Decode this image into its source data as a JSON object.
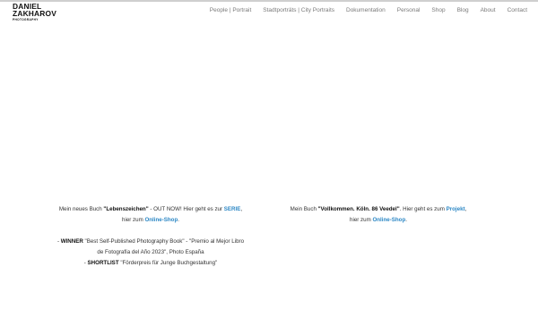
{
  "brand": {
    "line1": "DANIEL",
    "line2": "ZAKHAROV",
    "tagline": "PHOTOGRAPHY"
  },
  "nav": [
    {
      "label": "People | Portrait"
    },
    {
      "label": "Stadtporträts | City Portraits"
    },
    {
      "label": "Dokumentation"
    },
    {
      "label": "Personal"
    },
    {
      "label": "Shop"
    },
    {
      "label": "Blog"
    },
    {
      "label": "About"
    },
    {
      "label": "Contact"
    }
  ],
  "left": {
    "l1_pre": "Mein neues Buch ",
    "l1_title": "\"Lebenszeichen\"",
    "l1_mid": " - OUT NOW! Hier geht es zur ",
    "l1_link": "SERIE",
    "l1_end": ",",
    "l2_pre": "hier zum ",
    "l2_link": "Online-Shop",
    "l2_end": ".",
    "w_pre": "- ",
    "w_label": "WINNER",
    "w_text": " \"Best Self-Published Photography Book\" - \"Premio al Mejor Libro",
    "w_text2": "de Fotografía del Año 2023\", Photo España",
    "s_pre": "- ",
    "s_label": "SHORTLIST",
    "s_text": " \"Förderpreis für Junge Buchgestaltung\""
  },
  "right": {
    "l1_pre": "Mein Buch ",
    "l1_title": "\"Vollkommen. Köln. 86 Veedel\"",
    "l1_mid": ". Hier geht es zum ",
    "l1_link": "Projekt",
    "l1_end": ",",
    "l2_pre": "hier zum ",
    "l2_link": "Online-Shop",
    "l2_end": "."
  },
  "colors": {
    "link": "#2c87c5",
    "nav_text": "#7a7a7a",
    "body_text": "#333333"
  }
}
